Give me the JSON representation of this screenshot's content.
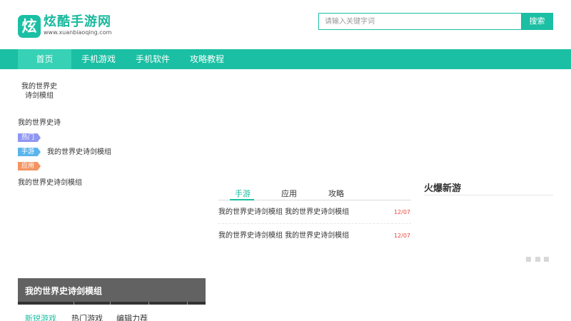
{
  "header": {
    "logo_mark": "炫",
    "logo_name": "炫酷手游网",
    "logo_url": "www.xuanbiaoqing.com",
    "search_placeholder": "请输入关键字词",
    "search_button": "搜索"
  },
  "nav": {
    "items": [
      {
        "label": "首页",
        "active": true
      },
      {
        "label": "手机游戏"
      },
      {
        "label": "手机软件"
      },
      {
        "label": "攻略教程"
      }
    ]
  },
  "left": {
    "crumb_line1": "我的世界史",
    "crumb_line2": "诗剑模组",
    "title": "我的世界史诗",
    "tags": [
      {
        "label": "热门",
        "text": ""
      },
      {
        "label": "手游",
        "text": "我的世界史诗剑模组"
      },
      {
        "label": "应用",
        "text": ""
      }
    ],
    "name_line": "我的世界史诗剑模组"
  },
  "tabs": {
    "items": [
      "手游",
      "应用",
      "攻略"
    ],
    "active": "手游",
    "rows": [
      {
        "name": "我的世界史诗剑模组   我的世界史诗剑模组",
        "date": "12/07"
      },
      {
        "name": "我的世界史诗剑模组   我的世界史诗剑模组",
        "date": "12/07"
      }
    ]
  },
  "right": {
    "title": "火爆新游"
  },
  "bottom": {
    "banner_title": "我的世界史诗剑模组",
    "tabs": [
      "新锐游戏",
      "热门游戏",
      "编辑力荐"
    ]
  },
  "colors": {
    "accent": "#1bbfa3",
    "nav_active": "#37d1b6",
    "date": "#e5473b",
    "tag_hot": "#8f96f2",
    "tag_game": "#5bb5ec",
    "tag_app": "#f39462",
    "banner": "#626262"
  }
}
